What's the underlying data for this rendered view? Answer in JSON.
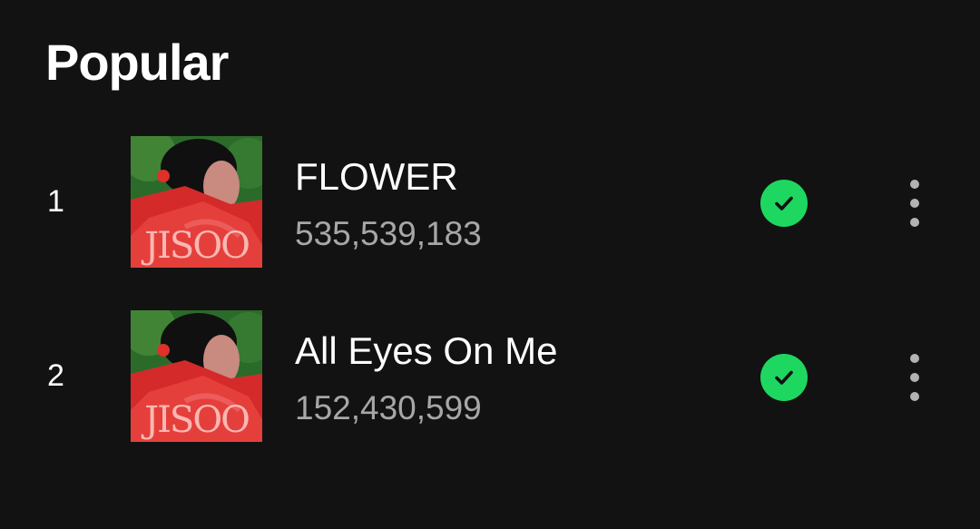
{
  "section": {
    "title": "Popular"
  },
  "tracks": [
    {
      "rank": "1",
      "title": "FLOWER",
      "plays": "535,539,183",
      "cover_text": "JISOO",
      "downloaded": true
    },
    {
      "rank": "2",
      "title": "All Eyes On Me",
      "plays": "152,430,599",
      "cover_text": "JISOO",
      "downloaded": true
    }
  ],
  "colors": {
    "background": "#121212",
    "accent": "#1ed760",
    "secondary_text": "#a7a7a7"
  },
  "icons": {
    "downloaded": "check-circle-icon",
    "more": "more-vertical-icon"
  }
}
